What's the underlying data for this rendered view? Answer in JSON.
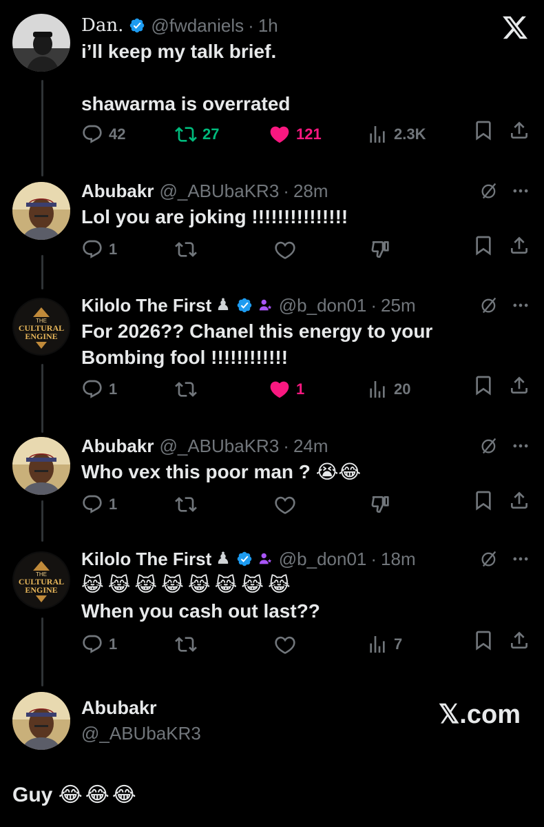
{
  "main_tweet": {
    "name": "Dan.",
    "handle": "@fwdaniels",
    "time": "1h",
    "text": "i’ll keep my talk brief.\n\nshawarma is overrated",
    "replies": "42",
    "retweets": "27",
    "likes": "121",
    "views": "2.3K"
  },
  "replies": [
    {
      "name": "Abubakr",
      "handle": "@_ABUbaKR3",
      "time": "28m",
      "text": "Lol you are joking !!!!!!!!!!!!!!!",
      "replies": "1",
      "likes": "",
      "views": ""
    },
    {
      "name": "Kilolo The First",
      "handle": "@b_don01",
      "time": "25m",
      "text": "For 2026?? Chanel this energy to your\nBombing fool !!!!!!!!!!!!",
      "replies": "1",
      "likes": "1",
      "views": "20"
    },
    {
      "name": "Abubakr",
      "handle": "@_ABUbaKR3",
      "time": "24m",
      "text": "Who vex this poor man ?",
      "emoji": "😭😂",
      "replies": "1",
      "likes": "",
      "views": ""
    },
    {
      "name": "Kilolo The First",
      "handle": "@b_don01",
      "time": "18m",
      "emoji": "😹😹😹😹😹😹😹😹",
      "text": "When you cash out last??",
      "replies": "1",
      "likes": "",
      "views": "7"
    }
  ],
  "footer": {
    "name": "Abubakr",
    "handle": "@_ABUbaKR3",
    "brand": "𝕏.com",
    "caption": "Guy",
    "caption_emoji": "😂😂😂"
  },
  "avatar_text": {
    "line1": "THE",
    "line2": "CULTURAL",
    "line3": "ENGINE"
  },
  "sep": "·",
  "colors": {
    "like_active": "#f91880",
    "retweet_active": "#00ba7c",
    "verified": "#1d9bf0",
    "muted": "#71767b",
    "affiliate": "#a855f7"
  },
  "icons": [
    "reply-icon",
    "retweet-icon",
    "heart-icon",
    "views-icon",
    "bookmark-icon",
    "share-icon",
    "close-icon",
    "grok-icon",
    "more-icon",
    "dislike-icon",
    "verified-icon"
  ]
}
